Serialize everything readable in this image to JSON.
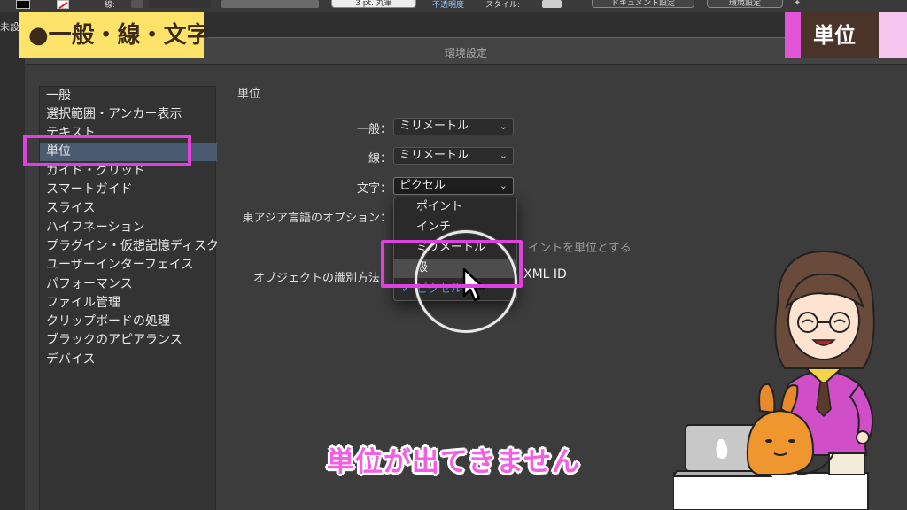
{
  "toolbar": {
    "stroke_label": "線:",
    "stroke_weight": "3 pt. 丸筆",
    "opacity_label": "不透明度",
    "style_label": "スタイル:",
    "doc_setup_button": "ドキュメント設定",
    "prefs_button": "環境設定",
    "left_fragment": "未設"
  },
  "dialog": {
    "title": "環境設定",
    "sidebar": [
      "一般",
      "選択範囲・アンカー表示",
      "テキスト",
      "単位",
      "ガイド・グリッド",
      "スマートガイド",
      "スライス",
      "ハイフネーション",
      "プラグイン・仮想記憶ディスク",
      "ユーザーインターフェイス",
      "パフォーマンス",
      "ファイル管理",
      "クリップボードの処理",
      "ブラックのアピアランス",
      "デバイス"
    ],
    "selected_item": "単位",
    "section_title": "単位",
    "general_label": "一般：",
    "general_value": "ミリメートル",
    "stroke_label": "線：",
    "stroke_value": "ミリメートル",
    "type_label": "文字：",
    "type_value": "ピクセル",
    "east_asian_label": "東アジア言語のオプション：",
    "east_asian_option_partial": "イントを単位とする",
    "object_id_label": "オブジェクトの識別方法：",
    "object_id_value": "XML ID",
    "dropdown_options": [
      "ポイント",
      "インチ",
      "ミリメートル",
      "級",
      "ピクセル"
    ],
    "dropdown_highlighted": "級",
    "dropdown_checked": "ピクセル"
  },
  "overlay": {
    "category_tag": "●一般・線・文字",
    "unit_tag": "単位",
    "caption": "単位が出てきません"
  },
  "colors": {
    "highlight_magenta": "#e040e0",
    "tag_yellow": "#fde36a",
    "caption_pink": "#f25ee4",
    "check_blue": "#4a90e8"
  }
}
